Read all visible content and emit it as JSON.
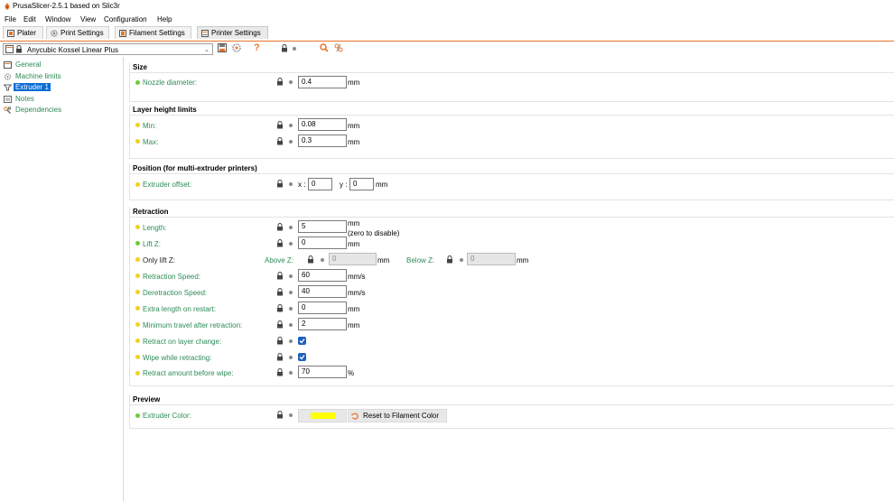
{
  "window": {
    "title": "PrusaSlicer-2.5.1 based on Slic3r"
  },
  "menu": [
    "File",
    "Edit",
    "Window",
    "View",
    "Configuration",
    "Help"
  ],
  "tabs": [
    {
      "label": "Plater",
      "icon": "plater-icon"
    },
    {
      "label": "Print Settings",
      "icon": "gear-icon"
    },
    {
      "label": "Filament Settings",
      "icon": "spool-icon"
    },
    {
      "label": "Printer Settings",
      "icon": "printer-icon",
      "active": true
    }
  ],
  "preset": {
    "value": "Anycubic Kossel Linear Plus"
  },
  "sidebar": {
    "items": [
      {
        "label": "General",
        "icon": "printer-icon"
      },
      {
        "label": "Machine limits",
        "icon": "cog-icon"
      },
      {
        "label": "Extruder 1",
        "icon": "funnel-icon",
        "selected": true
      },
      {
        "label": "Notes",
        "icon": "note-icon"
      },
      {
        "label": "Dependencies",
        "icon": "wrench-icon"
      }
    ]
  },
  "sections": {
    "size": {
      "title": "Size",
      "nozzle": {
        "label": "Nozzle diameter:",
        "value": "0.4",
        "unit": "mm"
      }
    },
    "layer": {
      "title": "Layer height limits",
      "min": {
        "label": "Min:",
        "value": "0.08",
        "unit": "mm"
      },
      "max": {
        "label": "Max:",
        "value": "0.3",
        "unit": "mm"
      }
    },
    "position": {
      "title": "Position (for multi-extruder printers)",
      "offset": {
        "label": "Extruder offset:",
        "x_label": "x :",
        "x_value": "0",
        "y_label": "y :",
        "y_value": "0",
        "unit": "mm"
      }
    },
    "retraction": {
      "title": "Retraction",
      "length": {
        "label": "Length:",
        "value": "5",
        "unit": "mm",
        "note": "(zero to disable)"
      },
      "lift_z": {
        "label": "Lift Z:",
        "value": "0",
        "unit": "mm"
      },
      "only_lift": {
        "label": "Only lift Z:",
        "above_label": "Above Z:",
        "above_value": "0",
        "above_unit": "mm",
        "below_label": "Below Z:",
        "below_value": "0",
        "below_unit": "mm"
      },
      "speed": {
        "label": "Retraction Speed:",
        "value": "60",
        "unit": "mm/s"
      },
      "deretract": {
        "label": "Deretraction Speed:",
        "value": "40",
        "unit": "mm/s"
      },
      "extra_length": {
        "label": "Extra length on restart:",
        "value": "0",
        "unit": "mm"
      },
      "min_travel": {
        "label": "Minimum travel after retraction:",
        "value": "2",
        "unit": "mm"
      },
      "layer_change": {
        "label": "Retract on layer change:",
        "checked": true
      },
      "wipe": {
        "label": "Wipe while retracting:",
        "checked": true
      },
      "before_wipe": {
        "label": "Retract amount before wipe:",
        "value": "70",
        "unit": "%"
      }
    },
    "preview": {
      "title": "Preview",
      "color": {
        "label": "Extruder Color:",
        "swatch": "#ffff00",
        "reset_label": "Reset to Filament Color"
      }
    }
  },
  "colors": {
    "accent": "#e8742a",
    "label_green": "#2e8b57",
    "dot_green": "#6ccb3c",
    "dot_yellow": "#f2d21c",
    "checkbox_blue": "#1d61bd",
    "selection": "#0a6cd6"
  }
}
